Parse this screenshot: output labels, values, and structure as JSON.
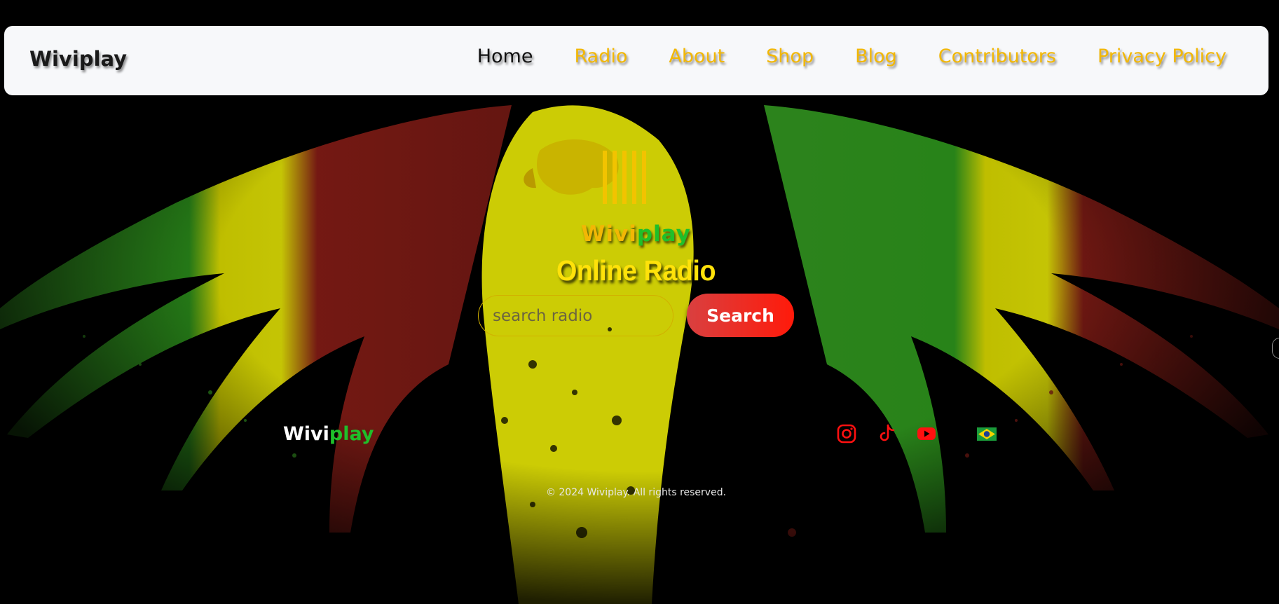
{
  "navbar": {
    "brand": "Wiviplay",
    "items": [
      {
        "label": "Home",
        "active": true
      },
      {
        "label": "Radio"
      },
      {
        "label": "About"
      },
      {
        "label": "Shop"
      },
      {
        "label": "Blog"
      },
      {
        "label": "Contributors"
      },
      {
        "label": "Privacy Policy"
      }
    ]
  },
  "hero": {
    "logo_icon": "bars-logo-icon",
    "brand_part1": "Wivi",
    "brand_part2": "play",
    "title": "Online Radio",
    "search_placeholder": "search radio",
    "search_button": "Search"
  },
  "footer": {
    "brand_part1": "Wivi",
    "brand_part2": "play",
    "social": [
      "instagram-icon",
      "tiktok-icon",
      "youtube-icon",
      "brazil-flag-icon"
    ],
    "copyright": "© 2024 Wiviplay. All rights reserved."
  },
  "colors": {
    "accent_yellow": "#f2b705",
    "brand_green": "#1fbf2a",
    "search_red": "#ff1a0a",
    "social_red": "#ff1010"
  }
}
